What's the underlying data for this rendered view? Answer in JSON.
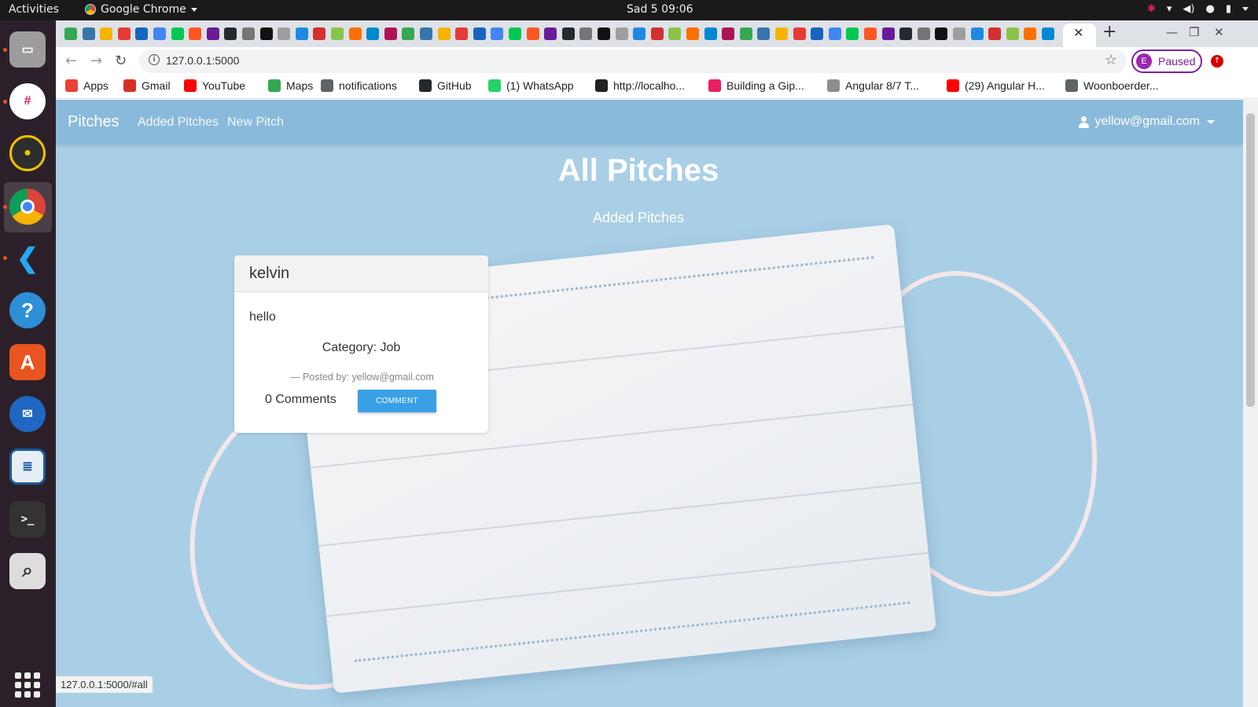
{
  "topbar": {
    "activities": "Activities",
    "app_name": "Google Chrome",
    "clock": "Sad 5  09:06",
    "tray_icons": [
      "slack-tray-icon",
      "wifi-icon",
      "volume-icon",
      "microphone-icon",
      "battery-icon"
    ]
  },
  "dock": {
    "items": [
      "files",
      "slack",
      "rhythmbox",
      "google-chrome",
      "vscode",
      "help",
      "ubuntu-software",
      "thunderbird",
      "libreoffice-writer",
      "terminal",
      "image-viewer"
    ],
    "show_apps": "show-applications"
  },
  "browser": {
    "url": "127.0.0.1:5000",
    "profile_initial": "E",
    "profile_status": "Paused",
    "status_url": "127.0.0.1:5000/#all",
    "tab_count": 56,
    "bookmarks": [
      {
        "label": "Apps",
        "icon": "apps-grid-icon",
        "color": "#ea4335"
      },
      {
        "label": "Gmail",
        "icon": "gmail-icon",
        "color": "#d93025"
      },
      {
        "label": "YouTube",
        "icon": "youtube-icon",
        "color": "#ff0000"
      },
      {
        "label": "Maps",
        "icon": "maps-pin-icon",
        "color": "#34a853"
      },
      {
        "label": "notifications",
        "icon": "globe-icon",
        "color": "#5f6368"
      },
      {
        "label": "GitHub",
        "icon": "github-icon",
        "color": "#24292e"
      },
      {
        "label": "(1) WhatsApp",
        "icon": "whatsapp-icon",
        "color": "#25d366"
      },
      {
        "label": "http://localho...",
        "icon": "angular-icon",
        "color": "#222222"
      },
      {
        "label": "Building a Gip...",
        "icon": "record-icon",
        "color": "#e91e63"
      },
      {
        "label": "Angular 8/7 T...",
        "icon": "castle-icon",
        "color": "#8d8d8d"
      },
      {
        "label": "(29) Angular H...",
        "icon": "youtube-icon",
        "color": "#ff0000"
      },
      {
        "label": "Woonboerder...",
        "icon": "globe-icon",
        "color": "#5f6368"
      }
    ]
  },
  "navbar": {
    "brand": "Pitches",
    "links": [
      "Added Pitches",
      "New Pitch"
    ],
    "user_email": "yellow@gmail.com"
  },
  "main": {
    "title": "All Pitches",
    "subtitle": "Added Pitches"
  },
  "pitch": {
    "author": "kelvin",
    "body": "hello",
    "category": "Category: Job",
    "posted_by": "— Posted by: yellow@gmail.com",
    "comments": "0 Comments",
    "comment_button": "COMMENT"
  },
  "colors": {
    "page_background": "#a9cfe7",
    "comment_button": "#3aa0e5",
    "profile_accent": "#7b1fa2",
    "ubuntu_orange": "#e95420"
  }
}
